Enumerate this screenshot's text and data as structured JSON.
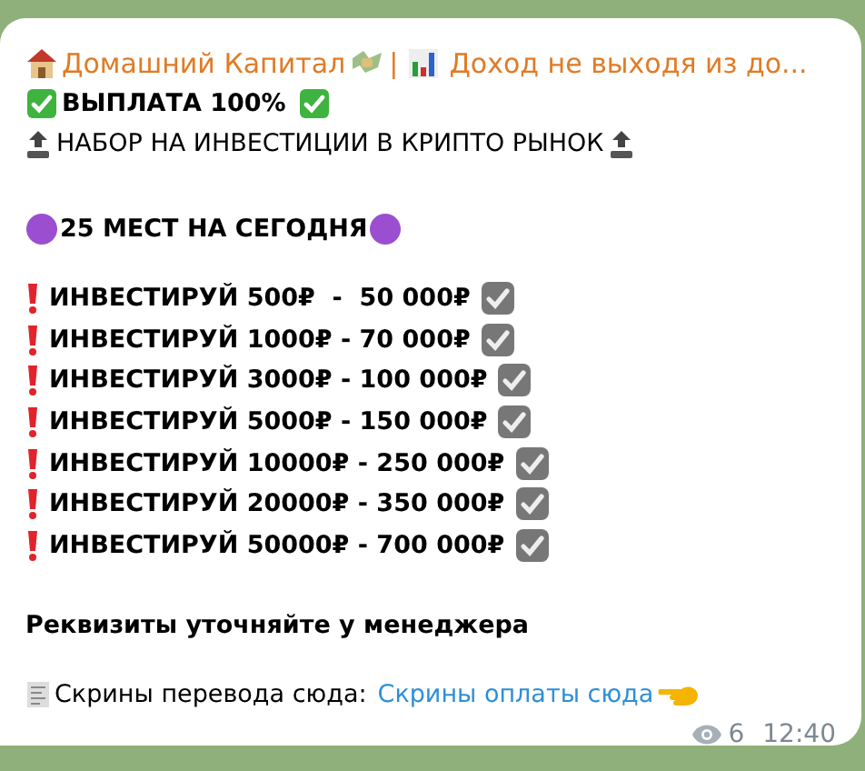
{
  "message": {
    "title_name": "Домашний Капитал",
    "title_separator": "|",
    "title_channel": "Доход не выходя из до...",
    "payout": "ВЫПЛАТА 100%",
    "recruit": "НАБОР НА ИНВЕСТИЦИИ В КРИПТО РЫНОК",
    "places": "25 МЕСТ НА СЕГОДНЯ",
    "offers": [
      {
        "text": "ИНВЕСТИРУЙ 500₽  -  50 000₽"
      },
      {
        "text": "ИНВЕСТИРУЙ 1000₽ - 70 000₽"
      },
      {
        "text": "ИНВЕСТИРУЙ 3000₽ - 100 000₽"
      },
      {
        "text": "ИНВЕСТИРУЙ 5000₽ - 150 000₽"
      },
      {
        "text": "ИНВЕСТИРУЙ 10000₽ - 250 000₽"
      },
      {
        "text": "ИНВЕСТИРУЙ 20000₽ - 350 000₽"
      },
      {
        "text": "ИНВЕСТИРУЙ 50000₽ - 700 000₽"
      }
    ],
    "details": "Реквизиты уточняйте у менеджера",
    "screens_label": "Скрины перевода сюда:",
    "screens_link": "Скрины оплаты сюда",
    "views": "6",
    "time": "12:40"
  }
}
